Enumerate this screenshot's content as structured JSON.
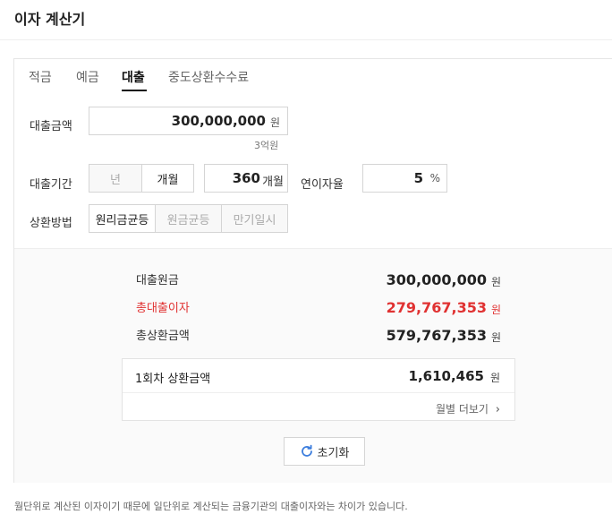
{
  "app": {
    "title": "이자 계산기"
  },
  "tabs": [
    {
      "label": "적금",
      "active": false
    },
    {
      "label": "예금",
      "active": false
    },
    {
      "label": "대출",
      "active": true
    },
    {
      "label": "중도상환수수료",
      "active": false
    }
  ],
  "loan_amount": {
    "label": "대출금액",
    "value": "300,000,000",
    "unit": "원",
    "hint": "3억원"
  },
  "loan_period": {
    "label": "대출기간",
    "unit_options": [
      "년",
      "개월"
    ],
    "selected_unit": "개월",
    "value": "360",
    "unit": "개월"
  },
  "interest_rate": {
    "label": "연이자율",
    "value": "5",
    "unit": "%"
  },
  "repayment": {
    "label": "상환방법",
    "options": [
      "원리금균등",
      "원금균등",
      "만기일시"
    ],
    "selected": "원리금균등"
  },
  "results": {
    "principal_label": "대출원금",
    "principal_value": "300,000,000",
    "interest_label": "총대출이자",
    "interest_value": "279,767,353",
    "total_label": "총상환금액",
    "total_value": "579,767,353",
    "unit": "원"
  },
  "monthly": {
    "label": "1회차 상환금액",
    "value": "1,610,465",
    "unit": "원",
    "more_label": "월별 더보기"
  },
  "reset_button": {
    "label": "초기화"
  },
  "footnote": "월단위로 계산된 이자이기 때문에 일단위로 계산되는 금융기관의 대출이자와는 차이가 있습니다.",
  "colors": {
    "accent_red": "#e03131",
    "refresh_icon": "#3b7ddd"
  }
}
